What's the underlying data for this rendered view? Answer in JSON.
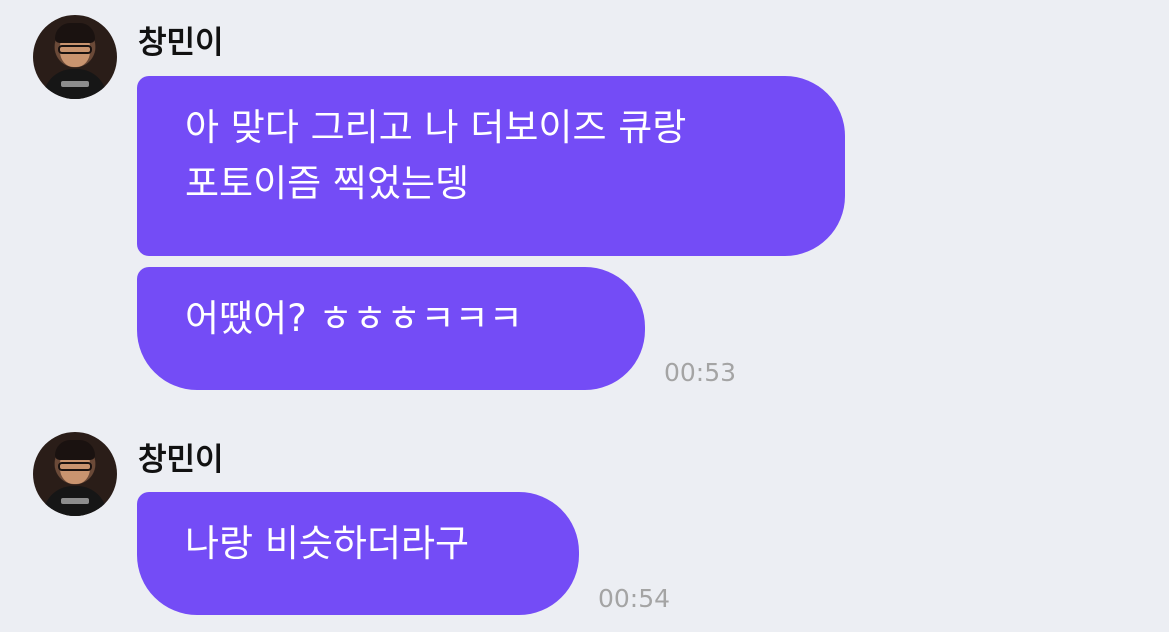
{
  "theme": {
    "background": "#eceef3",
    "bubble_color": "#744cf6",
    "bubble_text_color": "#ffffff",
    "time_color": "#a4a4a4"
  },
  "messages": [
    {
      "sender": "창민이",
      "avatar": "profile-photo",
      "bubbles": [
        "아 맞다 그리고 나 더보이즈 큐랑\n포토이즘 찍었는뎅",
        "어땠어? ㅎㅎㅎㅋㅋㅋ"
      ],
      "time": "00:53"
    },
    {
      "sender": "창민이",
      "avatar": "profile-photo",
      "bubbles": [
        "나랑 비슷하더라구"
      ],
      "time": "00:54"
    }
  ]
}
